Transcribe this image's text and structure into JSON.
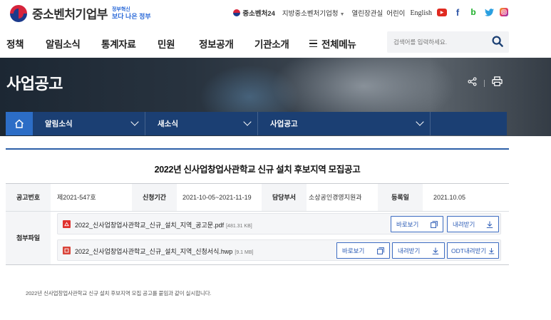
{
  "brand": {
    "logo_text": "중소벤처기업부",
    "slogan_top": "정부혁신",
    "slogan_bottom": "보다 나은 정부"
  },
  "utility": {
    "mark_label": "중소벤처24",
    "regional_label": "지방중소벤처기업청",
    "open_label": "열린장관실",
    "kids_label": "어린이",
    "english_label": "English"
  },
  "social": [
    "youtube-icon",
    "facebook-icon",
    "blog-icon",
    "twitter-icon",
    "instagram-icon"
  ],
  "nav": {
    "items": [
      "정책",
      "알림소식",
      "통계자료",
      "민원",
      "정보공개",
      "기관소개"
    ],
    "all_menu_label": "전체메뉴",
    "search_placeholder": "검색어를 입력하세요."
  },
  "hero": {
    "title": "사업공고"
  },
  "breadcrumb": {
    "items": [
      "알림소식",
      "새소식",
      "사업공고"
    ]
  },
  "post": {
    "title": "2022년 신사업창업사관학교 신규 설치 후보지역 모집공고",
    "meta": {
      "number_label": "공고번호",
      "number_value": "제2021-547호",
      "period_label": "신청기간",
      "period_value": "2021-10-05~2021-11-19",
      "dept_label": "담당부서",
      "dept_value": "소상공인경영지원과",
      "date_label": "등록일",
      "date_value": "2021.10.05"
    },
    "attachments_label": "첨부파일",
    "files": [
      {
        "name": "2022_신사업창업사관학교_신규_설치_지역_공고문.pdf",
        "size": "[481.31 KB]",
        "type_color": "#e0322f",
        "view_label": "바로보기",
        "download_label": "내려받기"
      },
      {
        "name": "2022_신사업창업사관학교_신규_설치_지역_신청서식.hwp",
        "size": "[9.1 MB]",
        "type_color": "#d9443a",
        "view_label": "바로보기",
        "download_label": "내려받기",
        "odt_label": "ODT내려받기"
      }
    ],
    "footnote": "2022년 신사업창업사관학교 신규 설치 후보지역 모집 공고를 붙임과 같이 실시합니다."
  },
  "colors": {
    "accent": "#2d5fa8",
    "breadcrumb_bg": "#1b3f73",
    "home_bg": "#2c6dc6",
    "button_border": "#3d6cc2"
  }
}
